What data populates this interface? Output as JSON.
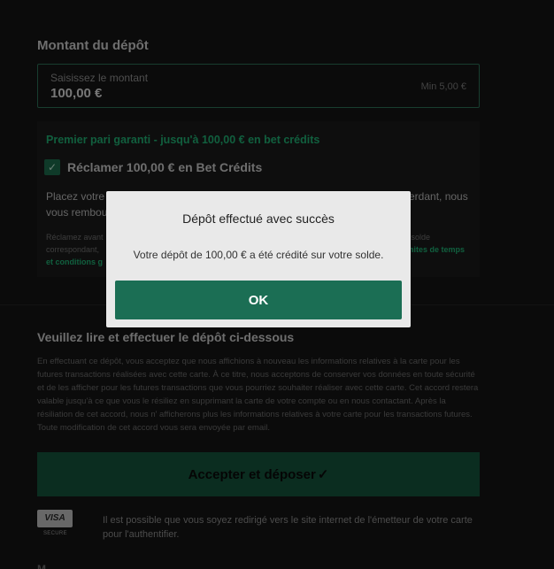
{
  "deposit": {
    "section_title": "Montant du dépôt",
    "amount_label": "Saisissez le montant",
    "amount_value": "100,00 €",
    "min_label": "Min 5,00 €"
  },
  "promo": {
    "headline": "Premier pari garanti - jusqu'à 100,00 € en bet crédits",
    "claim_checked": true,
    "claim_label": "Réclamer  100,00 €  en Bet Crédits",
    "body_line1": "Placez votre",
    "body_line1_right": "erdant, nous",
    "body_line2": "vous rembou",
    "small_line1": "Réclamez avant",
    "small_line1_right": "n solde",
    "small_line2": "correspondant,",
    "small_link1": "imites de temps",
    "small_link2": "et conditions g"
  },
  "terms": {
    "title": "Veuillez lire et effectuer le dépôt ci-dessous",
    "text": "En effectuant ce dépôt, vous acceptez que nous affichions à nouveau les informations relatives à la carte pour les futures transactions réalisées avec cette carte. À ce titre, nous acceptons de conserver vos données en toute sécurité et de les afficher pour les futures transactions que vous pourriez souhaiter réaliser avec cette carte. Cet accord restera valable jusqu'à ce que vous le résiliez en supprimant la carte de votre compte ou en nous contactant. Après la résiliation de cet accord, nous n' afficherons plus les informations relatives à votre carte pour les transactions futures. Toute modification de cet accord vous sera envoyée par email."
  },
  "accept_button": {
    "label": "Accepter et déposer",
    "check_glyph": "✓"
  },
  "visa": {
    "logo_text": "VISA",
    "sub_text": "SECURE",
    "redirect_text": "Il est possible que vous soyez redirigé vers le site internet de l'émetteur de votre carte pour l'authentifier."
  },
  "bottom_partial": "M",
  "modal": {
    "title": "Dépôt effectué avec succès",
    "message": "Votre dépôt de 100,00 € a été crédité sur votre solde.",
    "ok_label": "OK"
  },
  "colors": {
    "accent_green": "#1fae72",
    "button_green": "#1b6e54",
    "background": "#141414"
  }
}
